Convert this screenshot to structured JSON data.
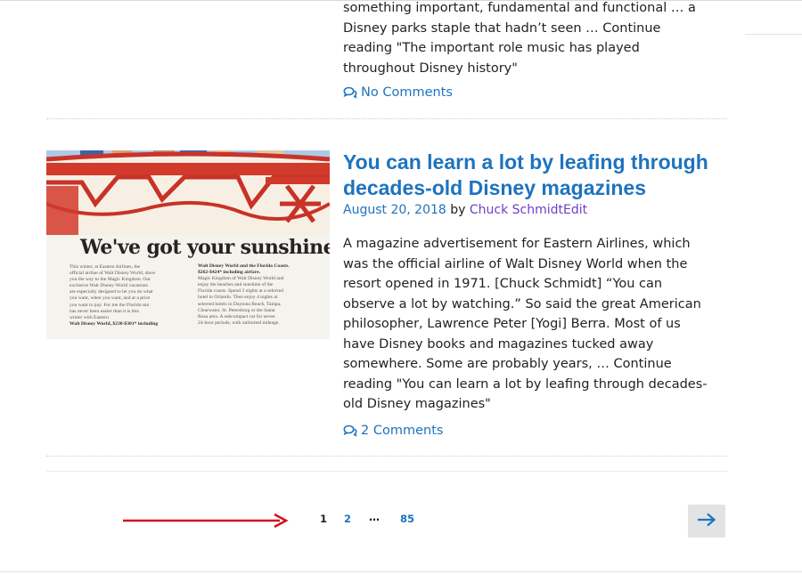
{
  "previous_post": {
    "excerpt": "something important, fundamental and functional … a Disney parks staple that hadn’t seen … Continue reading \"The important role music has played throughout Disney history\"",
    "comments_label": "No Comments",
    "comments_icon": "comment-bubbles-icon"
  },
  "post": {
    "title": "You can learn a lot by leafing through decades-old Disney magazines",
    "date": "August 20, 2018",
    "by": "by",
    "author": "Chuck Schmidt",
    "edit_label": "Edit",
    "excerpt": "A magazine advertisement for Eastern Airlines, which was the official airline of Walt Disney World when the resort opened in 1971. [Chuck Schmidt] “You can observe a lot by watching.” So said the great American philosopher, Lawrence Peter [Yogi] Berra. Most of us have Disney books and magazines tucked away somewhere. Some are probably years, … Continue reading \"You can learn a lot by leafing through decades-old Disney magazines\"",
    "comments_label": "2 Comments",
    "comments_icon": "comment-bubbles-icon",
    "thumbnail": {
      "headline": "We've got your sunshine.",
      "left_col": [
        "This winter, at Eastern Airlines, the",
        "official airline of Walt Disney World, show",
        "you the way to the Magic Kingdom. Our",
        "exclusive Walt Disney World vacations",
        "are especially designed to let you do what",
        "you want, when you want, and at a price",
        "you want to pay. For me the Florida sun",
        "has never been easier than it is this",
        "winter with Eastern."
      ],
      "left_tail": "Walt Disney World, $230-$301* including",
      "right_head": "Walt Disney World and the Florida Coasts.",
      "right_sub": "$262-$424* including airfare.",
      "right_col": [
        "Magic Kingdom of Walt Disney World and",
        "enjoy the beaches and sunshine of the",
        "Florida coasts. Spend 3 nights at a selected",
        "hotel in Orlando. Then enjoy 4 nights at",
        "selected hotels in Daytona Beach, Tampa,",
        "Clearwater, St. Petersburg or the Santa",
        "Rosa area. A subcompact car for seven",
        "24-hour periods, with unlimited mileage."
      ]
    }
  },
  "pagination": {
    "pages": [
      "1",
      "2",
      "85"
    ],
    "current": "1",
    "ellipsis": "…",
    "next_icon": "arrow-right-icon"
  },
  "annotation": {
    "arrow_icon": "red-arrow-icon",
    "color": "#d0121b"
  },
  "colors": {
    "link": "#1e73be",
    "author": "#6c3fc8",
    "text": "#222222",
    "next_bg": "#e1e3e5"
  }
}
